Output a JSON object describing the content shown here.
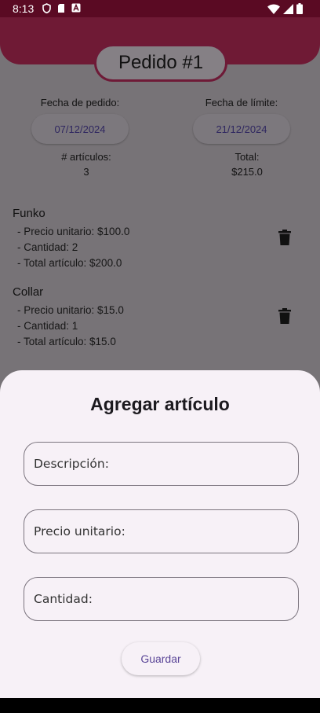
{
  "status_bar": {
    "time": "8:13",
    "icons_left": [
      "shield-icon",
      "sd-card-icon",
      "app-a-icon"
    ],
    "icons_right": [
      "wifi-icon",
      "signal-icon",
      "battery-icon"
    ]
  },
  "header": {
    "title": "Pedido #1",
    "color": "#7a1d3b"
  },
  "order": {
    "order_date_label": "Fecha de pedido:",
    "order_date_value": "07/12/2024",
    "limit_date_label": "Fecha de límite:",
    "limit_date_value": "21/12/2024",
    "items_count_label": "# artículos:",
    "items_count_value": "3",
    "total_label": "Total:",
    "total_value": "$215.0"
  },
  "items": [
    {
      "name": "Funko",
      "unit_price": "- Precio unitario: $100.0",
      "quantity": "- Cantidad: 2",
      "total": "- Total artículo: $200.0"
    },
    {
      "name": "Collar",
      "unit_price": "- Precio unitario: $15.0",
      "quantity": "- Cantidad: 1",
      "total": "- Total artículo: $15.0"
    }
  ],
  "sheet": {
    "title": "Agregar artículo",
    "description_label": "Descripción:",
    "unit_price_label": "Precio unitario:",
    "quantity_label": "Cantidad:",
    "save_label": "Guardar"
  },
  "colors": {
    "accent": "#5a4597",
    "sheet_background": "#f7f1f7",
    "scrim": "#777377"
  }
}
